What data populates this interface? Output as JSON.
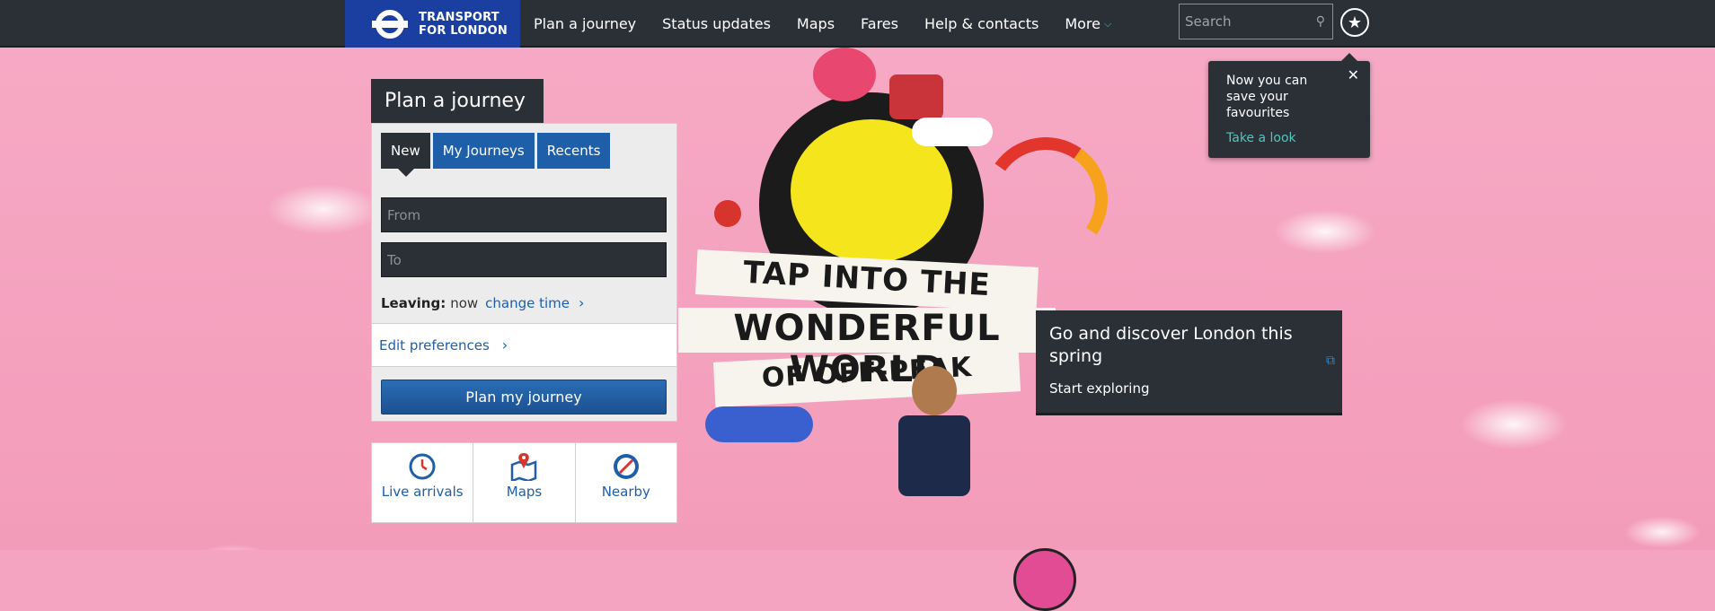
{
  "header": {
    "logo_line1": "TRANSPORT",
    "logo_line2": "FOR LONDON",
    "nav": [
      "Plan a journey",
      "Status updates",
      "Maps",
      "Fares",
      "Help & contacts"
    ],
    "more_label": "More",
    "search_placeholder": "Search",
    "favourites_icon": "star-icon"
  },
  "tooltip": {
    "text": "Now you can save your favourites",
    "link": "Take a look",
    "close": "✕"
  },
  "planner": {
    "title": "Plan a journey",
    "tabs": [
      "New",
      "My Journeys",
      "Recents"
    ],
    "active_tab": "New",
    "from_placeholder": "From",
    "to_placeholder": "To",
    "leaving_label": "Leaving:",
    "leaving_value": "now",
    "change_time": "change time",
    "edit_preferences": "Edit preferences",
    "submit": "Plan my journey"
  },
  "quick_links": [
    {
      "label": "Live arrivals",
      "icon": "clock-icon"
    },
    {
      "label": "Maps",
      "icon": "map-pin-icon"
    },
    {
      "label": "Nearby",
      "icon": "compass-icon"
    }
  ],
  "hero": {
    "line1": "TAP INTO THE",
    "line2": "WONDERFUL WORLD",
    "line3": "OF OFF-PEAK"
  },
  "promo": {
    "title": "Go and discover London this spring",
    "subtitle": "Start exploring"
  },
  "colors": {
    "background": "#f4a3c0",
    "dark": "#2b2f36",
    "brand_blue": "#1b3fa0",
    "link_blue": "#1f5ea8",
    "accent_teal": "#4fc6c0"
  }
}
